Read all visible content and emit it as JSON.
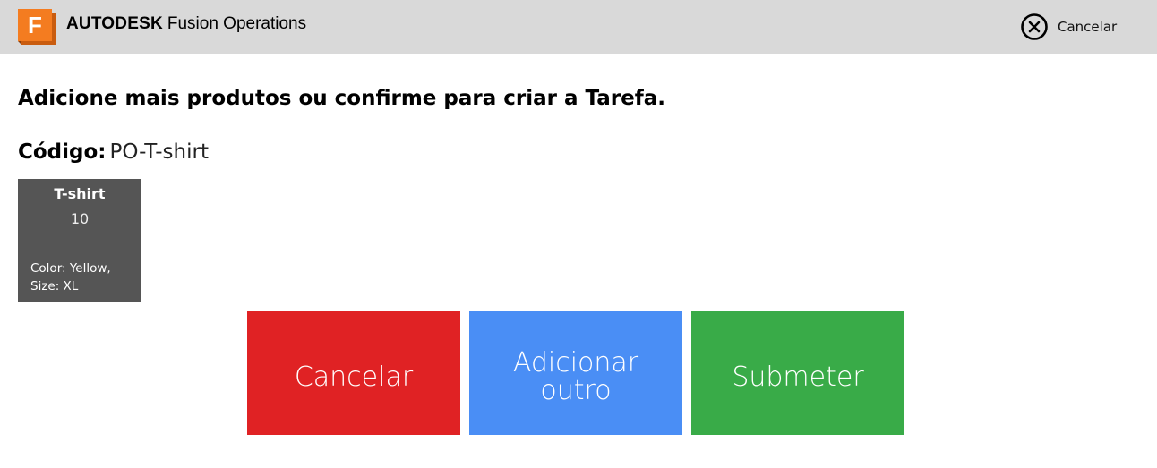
{
  "header": {
    "brand": "AUTODESK",
    "product": "Fusion Operations",
    "logo_letter": "F",
    "cancel_label": "Cancelar",
    "colors": {
      "background": "#d9d9d9",
      "logo_orange": "#f47c20",
      "logo_orange_dark": "#c95c0f"
    }
  },
  "instruction": "Adicione mais produtos ou confirme para criar a Tarefa.",
  "code": {
    "label": "Código:",
    "value": "PO-T-shirt"
  },
  "product_card": {
    "name": "T-shirt",
    "quantity": "10",
    "attribute_line1": "Color: Yellow,",
    "attribute_line2": "Size: XL",
    "background": "#555555"
  },
  "actions": {
    "cancel": {
      "label": "Cancelar",
      "color": "#e02224"
    },
    "add": {
      "line1": "Adicionar",
      "line2": "outro",
      "color": "#4a8ef5"
    },
    "submit": {
      "label": "Submeter",
      "color": "#39ab48"
    }
  },
  "icons": {
    "logo": "fusion-logo-icon",
    "cancel": "close-circle-icon"
  }
}
